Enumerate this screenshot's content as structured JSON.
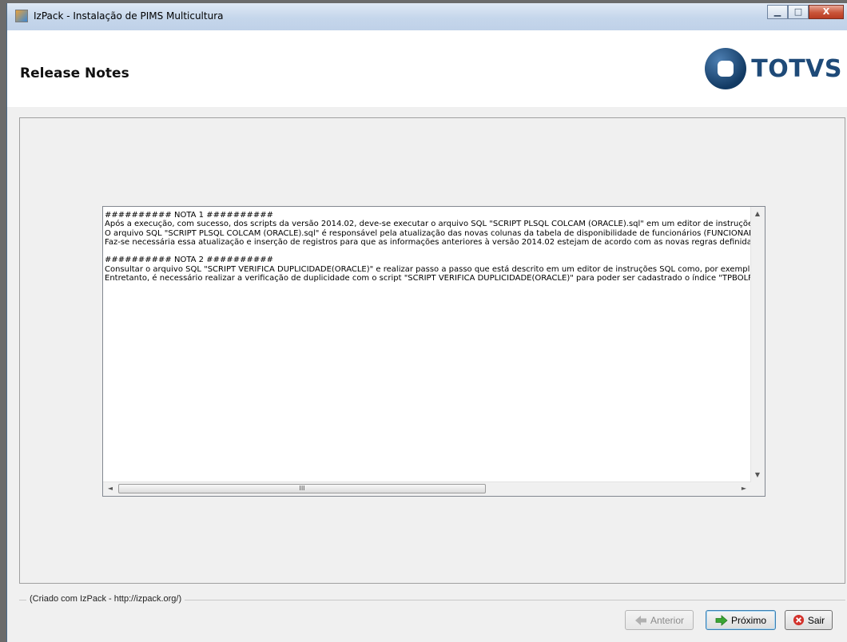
{
  "window": {
    "title": "IzPack - Instalação de PIMS Multicultura",
    "controls": {
      "minimize": "▁",
      "maximize": "□",
      "close": "X"
    }
  },
  "header": {
    "page_title": "Release Notes",
    "logo_text": "TOTVS",
    "logo_color": "#1e4a78"
  },
  "notes": {
    "lines": [
      "########## NOTA 1 ##########",
      "Após a execução, com sucesso, dos scripts da versão 2014.02, deve-se executar o arquivo SQL \"SCRIPT PLSQL COLCAM (ORACLE).sql\" em um editor de instruçõe",
      "O arquivo SQL \"SCRIPT PLSQL COLCAM (ORACLE).sql\" é responsável pela atualização das novas colunas da tabela de disponibilidade de funcionários (FUNCIONAR",
      "Faz-se necessária essa atualização e inserção de registros para que as informações anteriores à versão 2014.02 estejam de acordo com as novas regras definidas",
      "",
      "########## NOTA 2 ##########",
      "Consultar o arquivo SQL \"SCRIPT VERIFICA DUPLICIDADE(ORACLE)\" e realizar passo a passo que está descrito em um editor de instruções SQL como, por exemplo",
      "Entretanto, é necessário realizar a verificação de duplicidade com o script \"SCRIPT VERIFICA DUPLICIDADE(ORACLE)\" para poder ser cadastrado o índice \"TPBOLF"
    ],
    "scroll_thumb_grip": "III"
  },
  "footer": {
    "credit": "(Criado com IzPack - http://izpack.org/)",
    "buttons": {
      "previous": "Anterior",
      "next": "Próximo",
      "quit": "Sair"
    }
  }
}
